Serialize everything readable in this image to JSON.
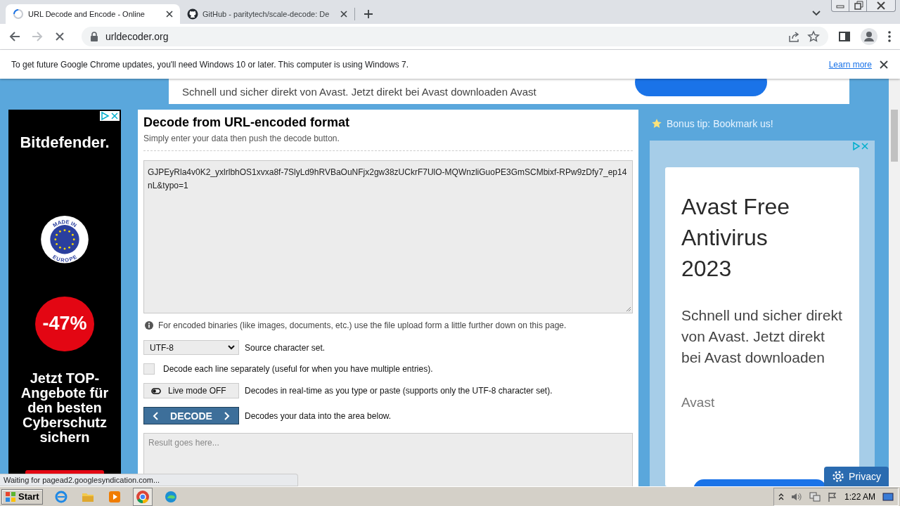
{
  "browser": {
    "tabs": [
      {
        "title": "URL Decode and Encode - Online",
        "selected": true,
        "loading": true
      },
      {
        "title": "GitHub - paritytech/scale-decode: De",
        "selected": false,
        "loading": false
      }
    ],
    "address": "urldecoder.org",
    "loading": true,
    "forward_disabled": true
  },
  "infobar": {
    "message": "To get future Google Chrome updates, you'll need Windows 10 or later. This computer is using Windows 7.",
    "link": "Learn more"
  },
  "top_ad": {
    "text": "Schnell und sicher direkt von Avast. Jetzt direkt bei Avast downloaden Avast"
  },
  "left_ad": {
    "brand": "Bitdefender.",
    "badge_top": "MADE IN",
    "badge_bottom": "EUROPE",
    "discount": "-47%",
    "headline": "Jetzt TOP-Angebote für den besten Cyberschutz sichern"
  },
  "decoder": {
    "title": "Decode from URL-encoded format",
    "subtitle": "Simply enter your data then push the decode button.",
    "input": "GJPEyRla4v0K2_yxlrlbhOS1xvxa8f-7SlyLd9hRVBaOuNFjx2gw38zUCkrF7UlO-MQWnzliGuoPE3GmSCMbixf-RPw9zDfy7_ep14nL&typo=1",
    "hint": "For encoded binaries (like images, documents, etc.) use the file upload form a little further down on this page.",
    "charset": "UTF-8",
    "charset_label": "Source character set.",
    "line_option": {
      "label": "Decode each line separately (useful for when you have multiple entries).",
      "checked": false
    },
    "live_mode": {
      "label": "Live mode OFF",
      "on": false,
      "description": "Decodes in real-time as you type or paste (supports only the UTF-8 character set)."
    },
    "decode_button": "DECODE",
    "decode_description": "Decodes your data into the area below.",
    "result_placeholder": "Result goes here..."
  },
  "sidebar": {
    "tip": "Bonus tip: Bookmark us!",
    "ad": {
      "title": "Avast Free Antivirus 2023",
      "body": "Schnell und sicher direkt von Avast. Jetzt direkt bei Avast downloaden",
      "advertiser": "Avast"
    }
  },
  "status_text": "Waiting for pagead2.googlesyndication.com...",
  "privacy_button": "Privacy",
  "taskbar": {
    "start": "Start",
    "clock": "1:22 AM"
  }
}
